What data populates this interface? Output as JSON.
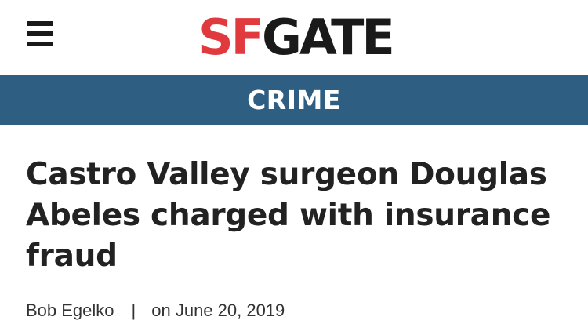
{
  "header": {
    "logo": {
      "part1": "SF",
      "part2": "GATE"
    },
    "menu_icon": "hamburger-menu-icon"
  },
  "section": {
    "label": "CRIME"
  },
  "article": {
    "headline": "Castro Valley surgeon Douglas Abeles charged with insurance fraud",
    "author": "Bob Egelko",
    "separator": "|",
    "date": "on June 20, 2019"
  },
  "colors": {
    "logo_red": "#e03a3e",
    "logo_dark": "#1a1a1a",
    "section_bar": "#2e5e82",
    "headline_text": "#222222"
  }
}
